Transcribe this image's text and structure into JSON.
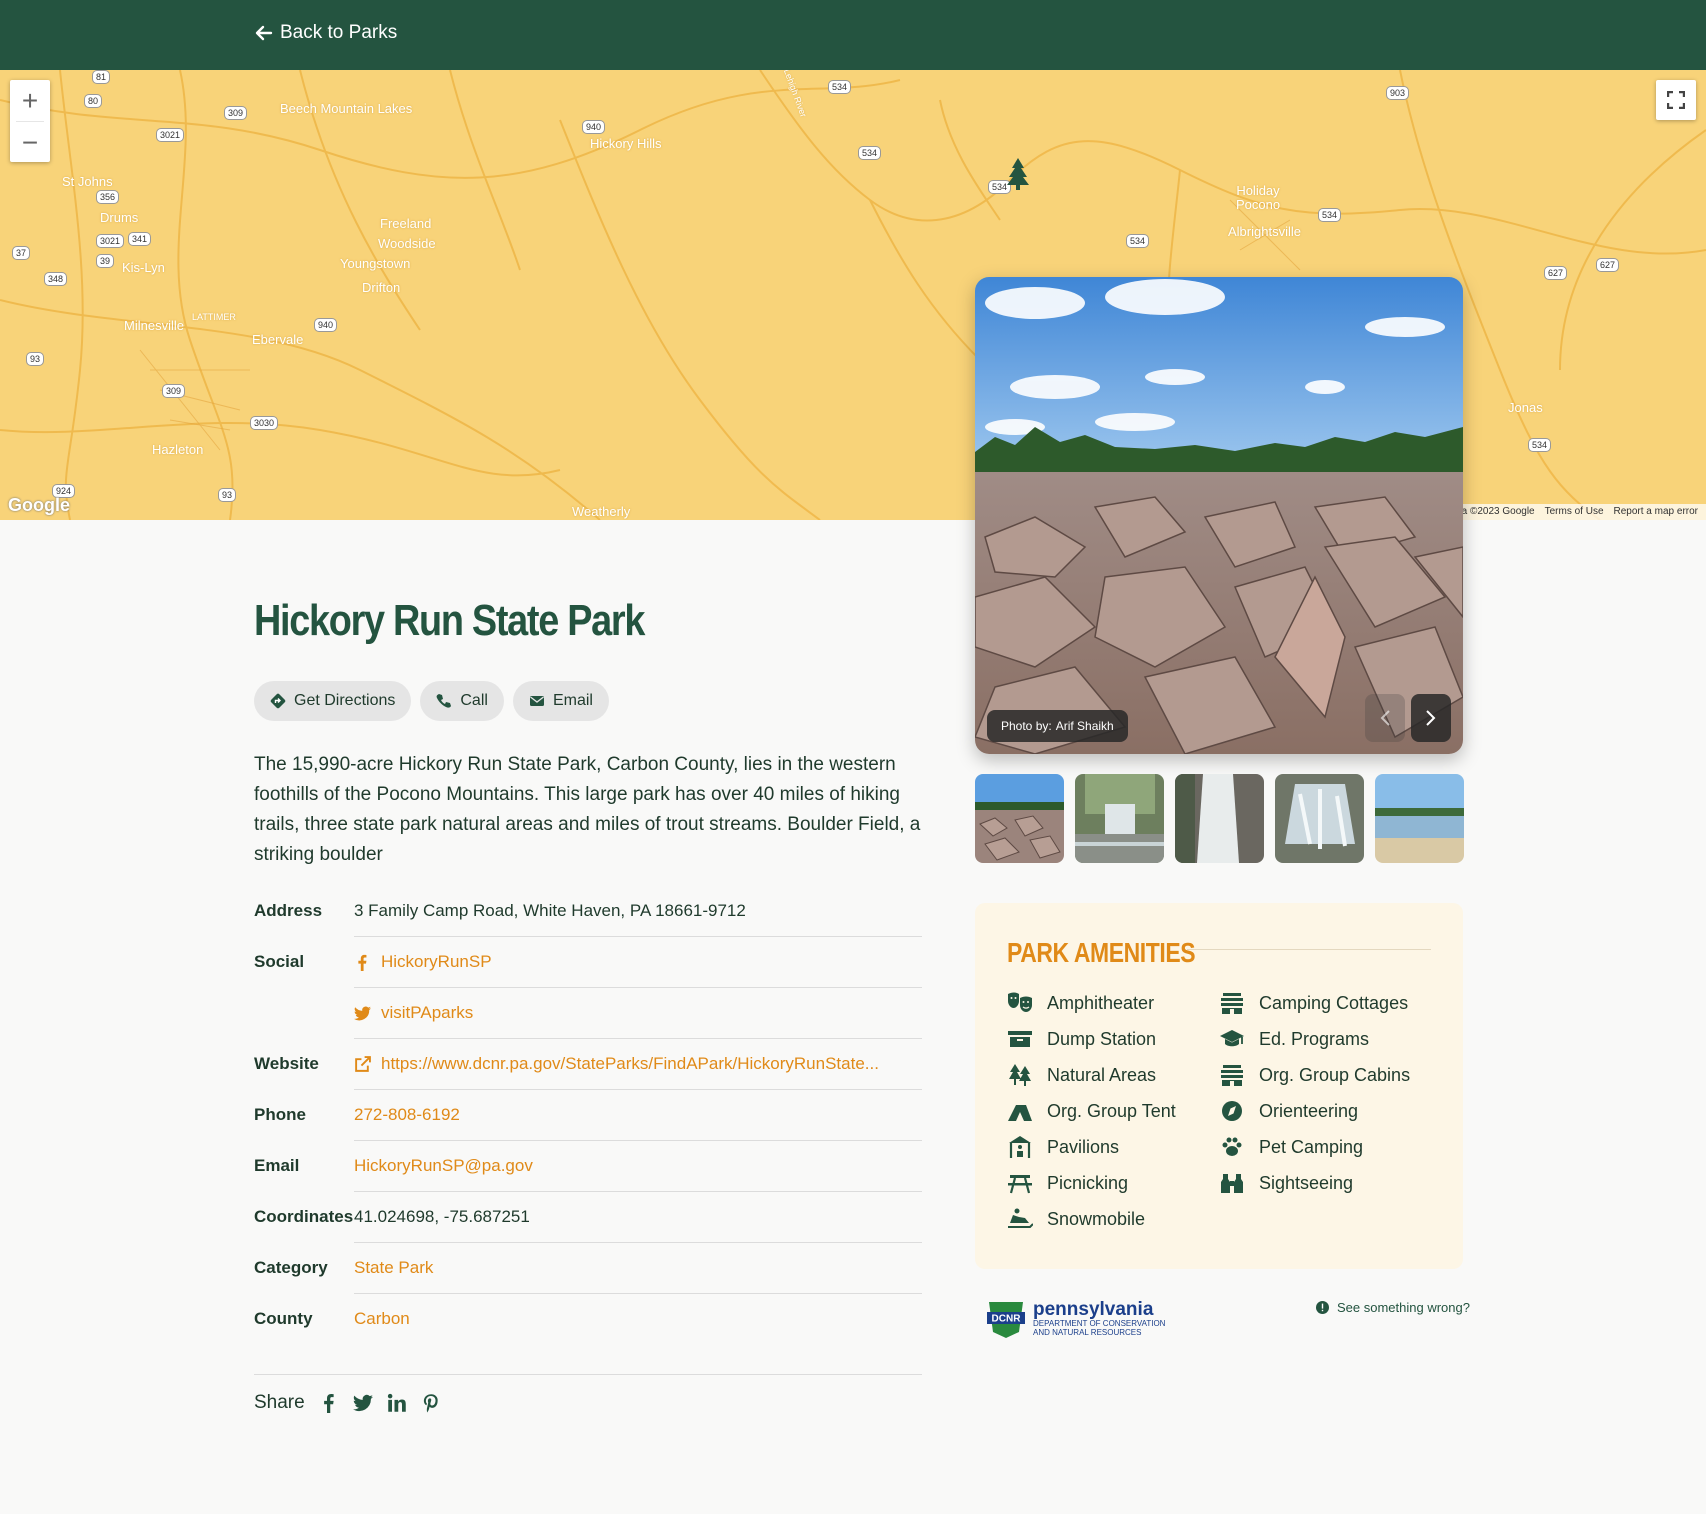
{
  "nav": {
    "back_label": "Back to Parks"
  },
  "map": {
    "labels": [
      "Beech Mountain Lakes",
      "Hickory Hills",
      "St Johns",
      "Drums",
      "Kis-Lyn",
      "Freeland",
      "Woodside",
      "Youngstown",
      "Drifton",
      "Milnesville",
      "LATTIMER",
      "Ebervale",
      "Hazleton",
      "Weatherly",
      "Holiday Pocono",
      "Albrightsville",
      "Jonas",
      "Lehigh River"
    ],
    "shields": [
      "81",
      "80",
      "309",
      "3021",
      "940",
      "534",
      "903",
      "356",
      "341",
      "39",
      "37",
      "348",
      "93",
      "627",
      "3030",
      "924"
    ],
    "google": "Google",
    "footer": [
      "Map data ©2023 Google",
      "Terms of Use",
      "Report a map error"
    ],
    "zoom_in": "+",
    "zoom_out": "−"
  },
  "park": {
    "title": "Hickory Run State Park",
    "actions": {
      "directions": "Get Directions",
      "call": "Call",
      "email": "Email"
    },
    "description": "The 15,990-acre Hickory Run State Park, Carbon County, lies in the western foothills of the Pocono Mountains. This large park has over 40 miles of hiking trails, three state park natural areas and miles of trout streams. Boulder Field, a striking boulder",
    "info": {
      "address_label": "Address",
      "address": "3 Family Camp Road, White Haven, PA 18661-9712",
      "social_label": "Social",
      "facebook": "HickoryRunSP",
      "twitter": "visitPAparks",
      "website_label": "Website",
      "website": "https://www.dcnr.pa.gov/StateParks/FindAPark/HickoryRunState...",
      "phone_label": "Phone",
      "phone": "272-808-6192",
      "email_label": "Email",
      "email": "HickoryRunSP@pa.gov",
      "coords_label": "Coordinates",
      "coords": "41.024698, -75.687251",
      "category_label": "Category",
      "category": "State Park",
      "county_label": "County",
      "county": "Carbon"
    },
    "share_label": "Share"
  },
  "gallery": {
    "credit_prefix": "Photo by:",
    "credit_name": "Arif Shaikh"
  },
  "amenities": {
    "title": "PARK AMENITIES",
    "items": [
      "Amphitheater",
      "Camping Cottages",
      "Dump Station",
      "Ed. Programs",
      "Natural Areas",
      "Org. Group Cabins",
      "Org. Group Tent",
      "Orienteering",
      "Pavilions",
      "Pet Camping",
      "Picnicking",
      "Sightseeing",
      "Snowmobile"
    ]
  },
  "footer": {
    "dcnr_name": "pennsylvania",
    "dcnr_sub1": "DEPARTMENT OF CONSERVATION",
    "dcnr_sub2": "AND NATURAL RESOURCES",
    "dcnr_logo": "DCNR",
    "report": "See something wrong?"
  },
  "colors": {
    "green": "#245440",
    "orange": "#e08a18",
    "map": "#f8d379",
    "cream": "#fdf6e6"
  }
}
